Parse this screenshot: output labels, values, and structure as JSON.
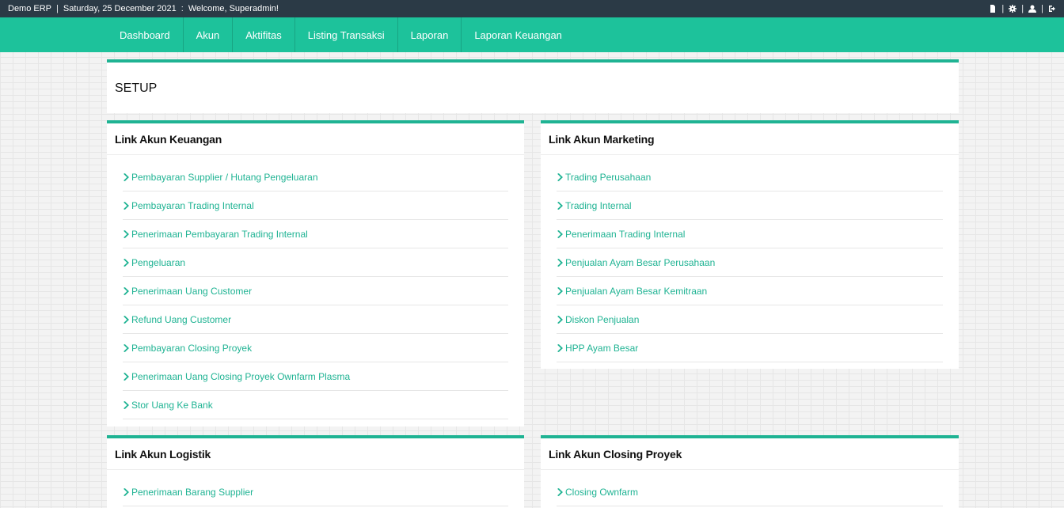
{
  "topbar": {
    "app_name": "Demo ERP",
    "date": "Saturday, 25 December 2021",
    "welcome": "Welcome, Superadmin!",
    "tools": [
      "file-icon",
      "gear-icon",
      "user-icon",
      "logout-icon"
    ]
  },
  "nav": {
    "items": [
      "Dashboard",
      "Akun",
      "Aktifitas",
      "Listing Transaksi",
      "Laporan",
      "Laporan Keuangan"
    ]
  },
  "setup": {
    "title": "SETUP"
  },
  "cards": [
    {
      "title": "Link Akun Keuangan",
      "links": [
        "Pembayaran Supplier / Hutang Pengeluaran",
        "Pembayaran Trading Internal",
        "Penerimaan Pembayaran Trading Internal",
        "Pengeluaran",
        "Penerimaan Uang Customer",
        "Refund Uang Customer",
        "Pembayaran Closing Proyek",
        "Penerimaan Uang Closing Proyek Ownfarm Plasma",
        "Stor Uang Ke Bank"
      ]
    },
    {
      "title": "Link Akun Marketing",
      "links": [
        "Trading Perusahaan",
        "Trading Internal",
        "Penerimaan Trading Internal",
        "Penjualan Ayam Besar Perusahaan",
        "Penjualan Ayam Besar Kemitraan",
        "Diskon Penjualan",
        "HPP Ayam Besar"
      ]
    },
    {
      "title": "Link Akun Logistik",
      "links": [
        "Penerimaan Barang Supplier"
      ]
    },
    {
      "title": "Link Akun Closing Proyek",
      "links": [
        "Closing Ownfarm"
      ]
    }
  ],
  "colors": {
    "accent": "#1dc29b",
    "topbar": "#2b3a46",
    "link": "#1fb393"
  }
}
